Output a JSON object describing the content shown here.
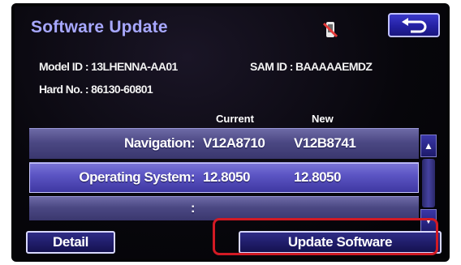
{
  "screen": {
    "title": "Software Update",
    "status_icon": "phone-disconnected-icon",
    "back_icon": "return-arrow-icon"
  },
  "info": {
    "model_id": "Model ID : 13LHENNA-AA01",
    "sam_id": "SAM ID : BAAAAAEMDZ",
    "hard_no": "Hard No. : 86130-60801"
  },
  "table": {
    "columns": {
      "current": "Current",
      "new": "New"
    },
    "rows": [
      {
        "label": "Navigation:",
        "current": "V12A8710",
        "new": "V12B8741",
        "selected": false
      },
      {
        "label": "Operating System:",
        "current": "12.8050",
        "new": "12.8050",
        "selected": true
      },
      {
        "label": ":",
        "current": "",
        "new": "",
        "selected": false
      }
    ]
  },
  "scroll": {
    "up_icon": "double-chevron-up-icon",
    "down_icon": "double-chevron-down-icon"
  },
  "buttons": {
    "detail": "Detail",
    "update": "Update Software"
  },
  "colors": {
    "title": "#a7a8ff",
    "highlight": "#d21a24",
    "button_blue": "#2320a3"
  }
}
